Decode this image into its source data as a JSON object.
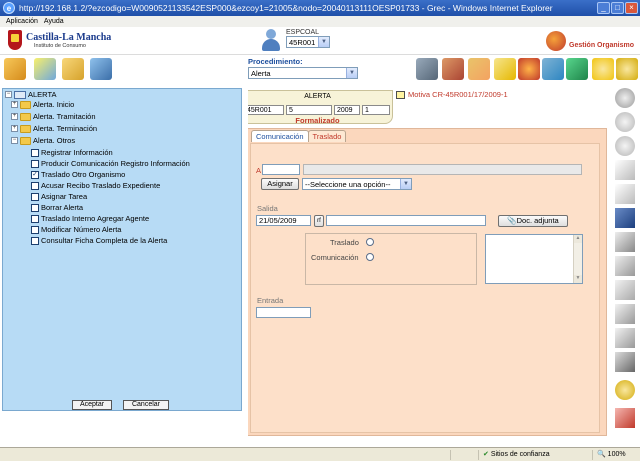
{
  "window": {
    "title": "http://192.168.1.2/?ezcodigo=W0090521133542ESP000&ezcoy1=21005&nodo=20040113111OESP01733 - Grec - Windows Internet Explorer"
  },
  "menu": [
    "Aplicación",
    "Ayuda"
  ],
  "header": {
    "logo_name": "Castilla-La Mancha",
    "logo_sub": "Instituto de Consumo",
    "user_name": "ESPCOAL",
    "user_office": "45R001",
    "app_section": "Gestión Organismo"
  },
  "procedure": {
    "label": "Procedimiento:",
    "value": "Alerta"
  },
  "alert_info": {
    "title": "ALERTA",
    "office": "45R001",
    "number": "5",
    "year": "2009",
    "seq": "1",
    "status": "Formalizado",
    "motiva": "Motiva CR-45R001/17/2009-1"
  },
  "tabs": [
    "Comunicación",
    "Traslado"
  ],
  "form": {
    "a_label": "A",
    "assign_button": "Asignar",
    "select_option": "--Seleccione una opción--",
    "salida_label": "Salida",
    "salida_date": "21/05/2009",
    "rf_label": "rf",
    "doc_button": "Doc. adjunta",
    "radio_traslado": "Traslado",
    "radio_comunicacion": "Comunicación",
    "entrada_label": "Entrada"
  },
  "tree": {
    "root": "ALERTA",
    "folders": [
      "Alerta. Inicio",
      "Alerta. Tramitación",
      "Alerta. Terminación",
      "Alerta. Otros"
    ],
    "items": [
      {
        "label": "Registrar Información",
        "checked": false
      },
      {
        "label": "Producir Comunicación Registro Información",
        "checked": false
      },
      {
        "label": "Traslado Otro Organismo",
        "checked": true
      },
      {
        "label": "Acusar Recibo Traslado Expediente",
        "checked": false
      },
      {
        "label": "Asignar Tarea",
        "checked": false
      },
      {
        "label": "Borrar Alerta",
        "checked": false
      },
      {
        "label": "Traslado Interno Agregar Agente",
        "checked": false
      },
      {
        "label": "Modificar Número Alerta",
        "checked": false
      },
      {
        "label": "Consultar Ficha Completa de la Alerta",
        "checked": false
      }
    ],
    "accept_button": "Aceptar",
    "cancel_button": "Cancelar"
  },
  "status": {
    "zone": "Sitios de confianza",
    "zoom": "100%"
  }
}
